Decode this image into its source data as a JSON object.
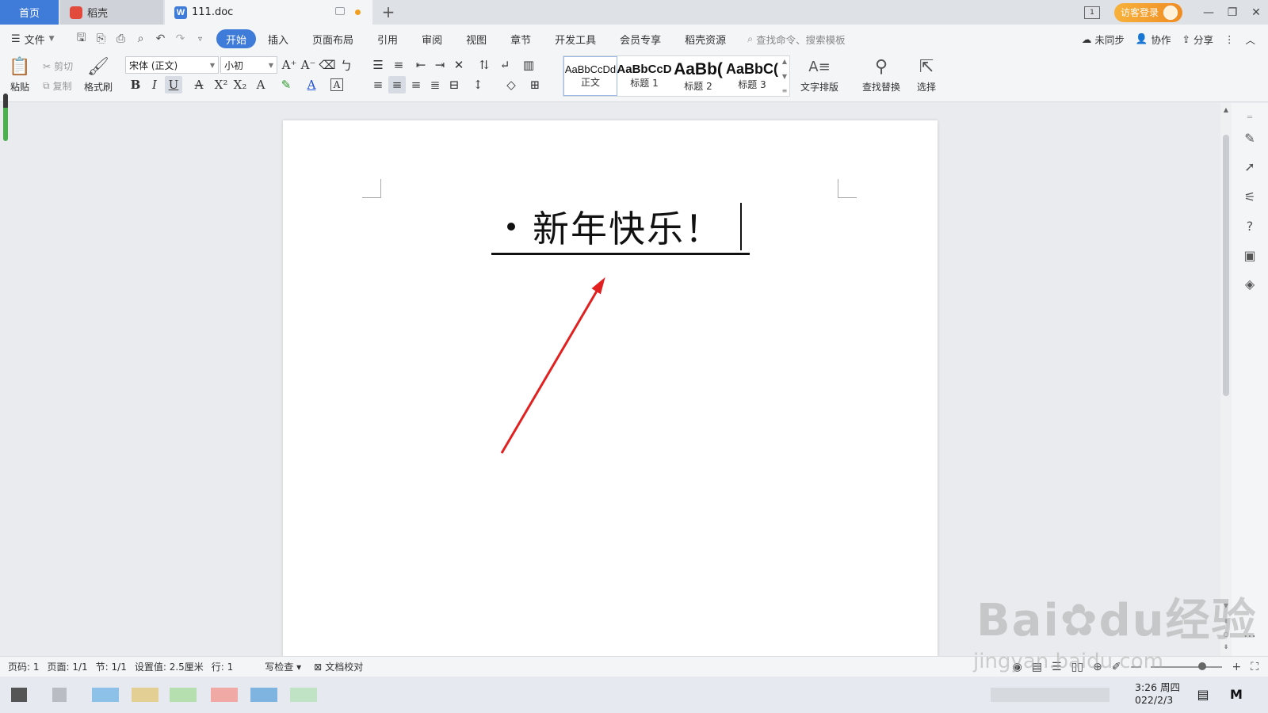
{
  "tabs": {
    "home": "首页",
    "daoke": "稻壳",
    "doc": "111.doc",
    "doc_icon_letter": "W"
  },
  "titlebar": {
    "window_mode": "1",
    "login_label": "访客登录"
  },
  "menubar": {
    "file_label": "文件",
    "tabs": [
      "开始",
      "插入",
      "页面布局",
      "引用",
      "审阅",
      "视图",
      "章节",
      "开发工具",
      "会员专享",
      "稻壳资源"
    ],
    "active_tab": "开始",
    "search_placeholder": "查找命令、搜索模板",
    "sync_label": "未同步",
    "collab_label": "协作",
    "share_label": "分享"
  },
  "ribbon": {
    "paste": "粘贴",
    "cut": "剪切",
    "copy": "复制",
    "format_painter": "格式刷",
    "font_name": "宋体 (正文)",
    "font_size": "小初",
    "styles": [
      {
        "sample": "AaBbCcDd",
        "label": "正文"
      },
      {
        "sample": "AaBbCcD",
        "label": "标题 1"
      },
      {
        "sample": "AaBb(",
        "label": "标题 2"
      },
      {
        "sample": "AaBbC(",
        "label": "标题 3"
      }
    ],
    "text_layout": "文字排版",
    "find_replace": "查找替换",
    "select": "选择"
  },
  "document": {
    "heading": "新年快乐！"
  },
  "statusbar": {
    "page_code": "页码: 1",
    "page": "页面: 1/1",
    "section": "节: 1/1",
    "setting": "设置值: 2.5厘米",
    "line": "行: 1",
    "spell_check": "写检查",
    "doc_proof": "文档校对"
  },
  "taskbar": {
    "time": "3:26 周四",
    "date": "022/2/3"
  },
  "watermark": {
    "brand": "Bai",
    "brand2": "du",
    "brand_cn": "经验",
    "url": "jingyan.baidu.com"
  },
  "colors": {
    "accent": "#3f7bd8",
    "login_orange": "#f08c23",
    "annotation_arrow": "#e32020"
  }
}
